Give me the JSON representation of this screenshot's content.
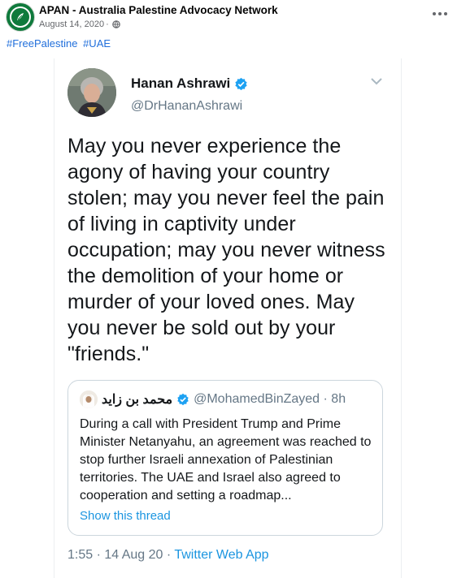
{
  "post": {
    "page_name": "APAN - Australia Palestine Advocacy Network",
    "date": "August 14, 2020",
    "separator": "·",
    "hashtags": [
      "#FreePalestine",
      "#UAE"
    ]
  },
  "tweet": {
    "name": "Hanan Ashrawi",
    "handle": "@DrHananAshrawi",
    "text": "May you never experience the agony of having your country stolen; may you never feel the pain of living in captivity under occupation; may you never witness the demolition of your home or murder of your loved ones. May you never be sold out by your \"friends.\"",
    "quote": {
      "name": "محمد بن زايد",
      "handle": "@MohamedBinZayed · 8h",
      "text": "During a call with President Trump and Prime Minister Netanyahu, an agreement was reached to stop further Israeli annexation of Palestinian territories. The UAE and Israel also agreed to cooperation and setting a roadmap...",
      "link": "Show this thread"
    },
    "footer_time": "1:55 · 14 Aug 20 · ",
    "footer_source": "Twitter Web App"
  },
  "icons": {
    "page_avatar": "apan-logo",
    "globe": "globe-icon",
    "more": "more-options-icon",
    "verified": "verified-badge-icon",
    "chevron": "chevron-down-icon"
  },
  "colors": {
    "facebook_link": "#216fdb",
    "twitter_blue": "#1b95e0",
    "verified_blue": "#1da1f2",
    "apan_green": "#0f7a3c"
  }
}
